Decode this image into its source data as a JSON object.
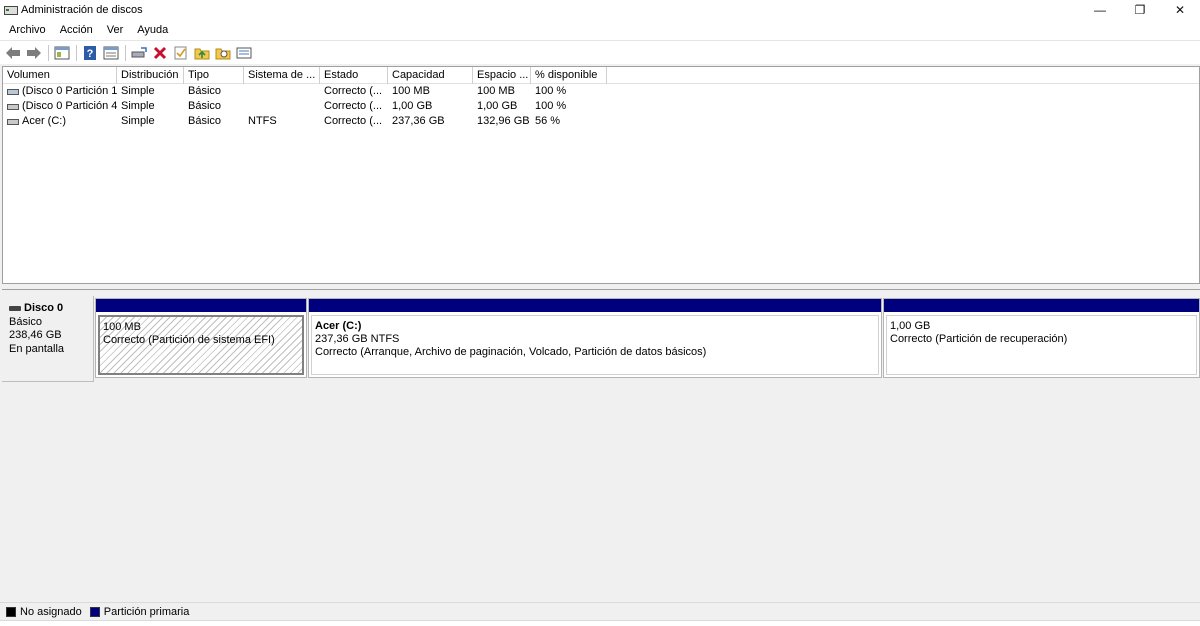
{
  "window": {
    "title": "Administración de discos",
    "controls": {
      "minimize": "—",
      "restore": "❐",
      "close": "✕"
    }
  },
  "menu": [
    "Archivo",
    "Acción",
    "Ver",
    "Ayuda"
  ],
  "toolbar": {
    "buttons": [
      "back-icon",
      "forward-icon",
      "console-tree-icon",
      "help-icon",
      "properties-icon",
      "connect-disk-icon",
      "delete-icon",
      "check-icon",
      "open-folder-icon",
      "search-folder-icon",
      "view-list-icon"
    ]
  },
  "volumes": {
    "headers": [
      "Volumen",
      "Distribución",
      "Tipo",
      "Sistema de ...",
      "Estado",
      "Capacidad",
      "Espacio ...",
      "% disponible"
    ],
    "rows": [
      {
        "volumen": "(Disco 0 Partición 1)",
        "distribucion": "Simple",
        "tipo": "Básico",
        "sistema": "",
        "estado": "Correcto (...",
        "capacidad": "100 MB",
        "espacio": "100 MB",
        "disponible": "100 %"
      },
      {
        "volumen": "(Disco 0 Partición 4)",
        "distribucion": "Simple",
        "tipo": "Básico",
        "sistema": "",
        "estado": "Correcto (...",
        "capacidad": "1,00 GB",
        "espacio": "1,00 GB",
        "disponible": "100 %"
      },
      {
        "volumen": "Acer (C:)",
        "distribucion": "Simple",
        "tipo": "Básico",
        "sistema": "NTFS",
        "estado": "Correcto (...",
        "capacidad": "237,36 GB",
        "espacio": "132,96 GB",
        "disponible": "56 %"
      }
    ]
  },
  "disk": {
    "name": "Disco 0",
    "type": "Básico",
    "size": "238,46 GB",
    "status": "En pantalla",
    "partitions": [
      {
        "name": "",
        "size": "100 MB",
        "status": "Correcto (Partición de sistema EFI)"
      },
      {
        "name": "Acer  (C:)",
        "size": "237,36 GB NTFS",
        "status": "Correcto (Arranque, Archivo de paginación, Volcado, Partición de datos básicos)"
      },
      {
        "name": "",
        "size": "1,00 GB",
        "status": "Correcto (Partición de recuperación)"
      }
    ]
  },
  "legend": {
    "unallocated": {
      "label": "No asignado",
      "color": "#000000"
    },
    "primary": {
      "label": "Partición primaria",
      "color": "#00007e"
    }
  }
}
